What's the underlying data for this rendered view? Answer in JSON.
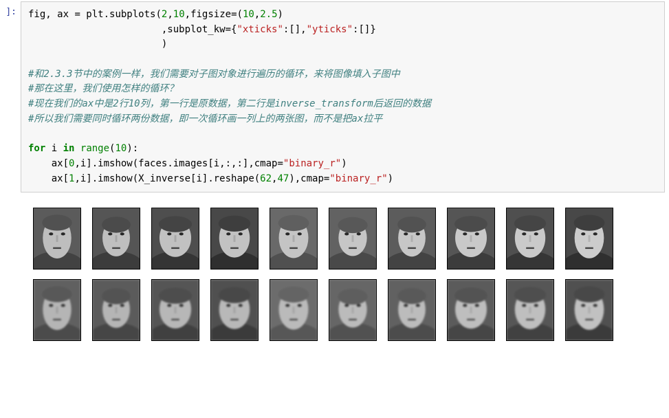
{
  "prompt": "]:",
  "code": {
    "l1_a": "fig, ax ",
    "l1_b": "=",
    "l1_c": " plt.subplots(",
    "l1_d": "2",
    "l1_e": ",",
    "l1_f": "10",
    "l1_g": ",figsize",
    "l1_h": "=",
    "l1_i": "(",
    "l1_j": "10",
    "l1_k": ",",
    "l1_l": "2.5",
    "l1_m": ")",
    "l2_a": "                       ,subplot_kw",
    "l2_b": "=",
    "l2_c": "{",
    "l2_d": "\"xticks\"",
    "l2_e": ":[],",
    "l2_f": "\"yticks\"",
    "l2_g": ":[]}",
    "l3": "                       )",
    "blank1": "",
    "c1": "#和2.3.3节中的案例一样，我们需要对子图对象进行遍历的循环，来将图像填入子图中",
    "c2": "#那在这里，我们使用怎样的循环？",
    "c3": "#现在我们的ax中是2行10列，第一行是原数据，第二行是inverse_transform后返回的数据",
    "c4": "#所以我们需要同时循环两份数据，即一次循环画一列上的两张图，而不是把ax拉平",
    "blank2": "",
    "l10_a": "for",
    "l10_b": " i ",
    "l10_c": "in",
    "l10_d": " ",
    "l10_e": "range",
    "l10_f": "(",
    "l10_g": "10",
    "l10_h": "):",
    "l11_a": "    ax[",
    "l11_b": "0",
    "l11_c": ",i].imshow(faces.images[i,:,:],cmap",
    "l11_d": "=",
    "l11_e": "\"binary_r\"",
    "l11_f": ")",
    "l12_a": "    ax[",
    "l12_b": "1",
    "l12_c": ",i].imshow(X_inverse[i].reshape(",
    "l12_d": "62",
    "l12_e": ",",
    "l12_f": "47",
    "l12_g": "),cmap",
    "l12_h": "=",
    "l12_i": "\"binary_r\"",
    "l12_j": ")"
  },
  "output": {
    "rows": 2,
    "cols": 10,
    "cmap": "binary_r"
  }
}
